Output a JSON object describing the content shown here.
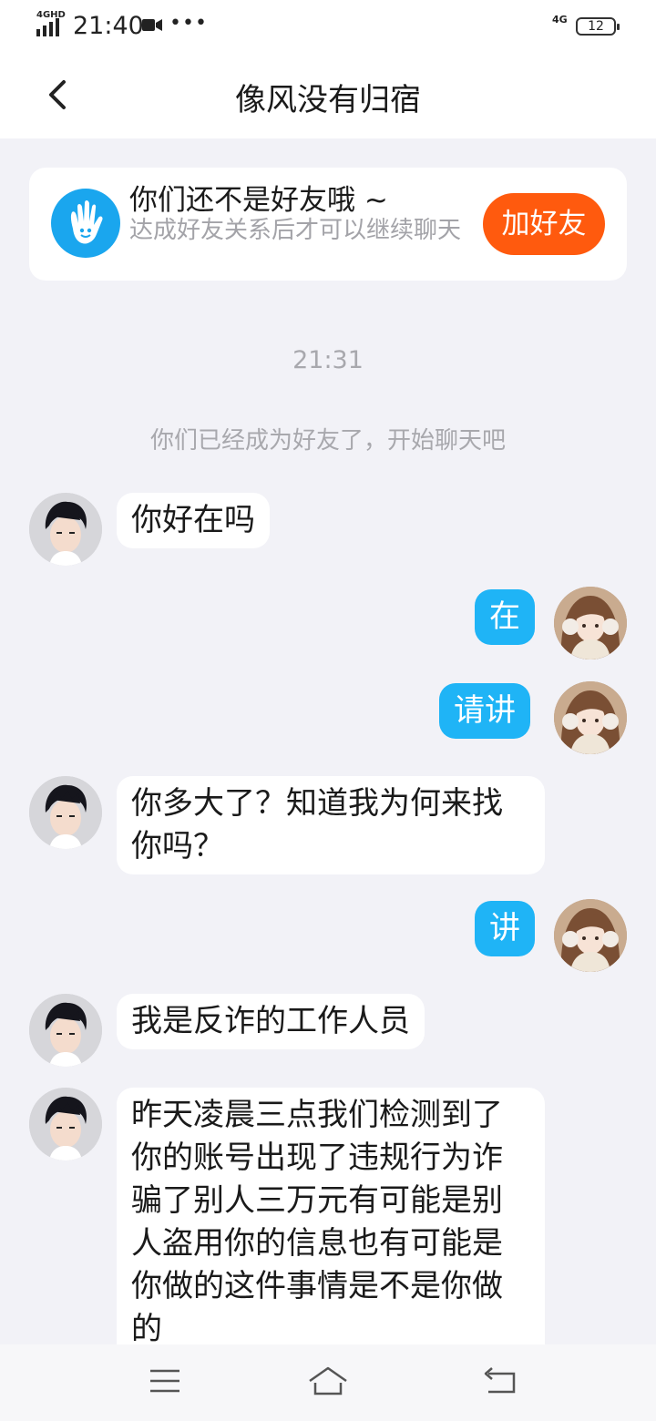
{
  "status_bar": {
    "network": "4GHD",
    "time": "21:40",
    "dots": "•••",
    "signal_4g": "4G",
    "battery": "12"
  },
  "header": {
    "title": "像风没有归宿"
  },
  "banner": {
    "title": "你们还不是好友哦 ~",
    "subtitle": "达成好友关系后才可以继续聊天",
    "button": "加好友"
  },
  "chat": {
    "timestamp": "21:31",
    "system_message": "你们已经成为好友了，开始聊天吧",
    "messages": [
      {
        "side": "in",
        "text": "你好在吗"
      },
      {
        "side": "out",
        "text": "在"
      },
      {
        "side": "out",
        "text": "请讲"
      },
      {
        "side": "in",
        "text": "你多大了？知道我为何来找你吗？"
      },
      {
        "side": "out",
        "text": "讲"
      },
      {
        "side": "in",
        "text": "我是反诈的工作人员"
      },
      {
        "side": "in",
        "text": "昨天凌晨三点我们检测到了你的账号出现了违规行为诈骗了别人三万元有可能是别人盗用你的信息也有可能是你做的这件事情是不是你做的"
      }
    ]
  },
  "nav_bar": {
    "icons": [
      "menu-icon",
      "home-icon",
      "back-icon"
    ]
  }
}
